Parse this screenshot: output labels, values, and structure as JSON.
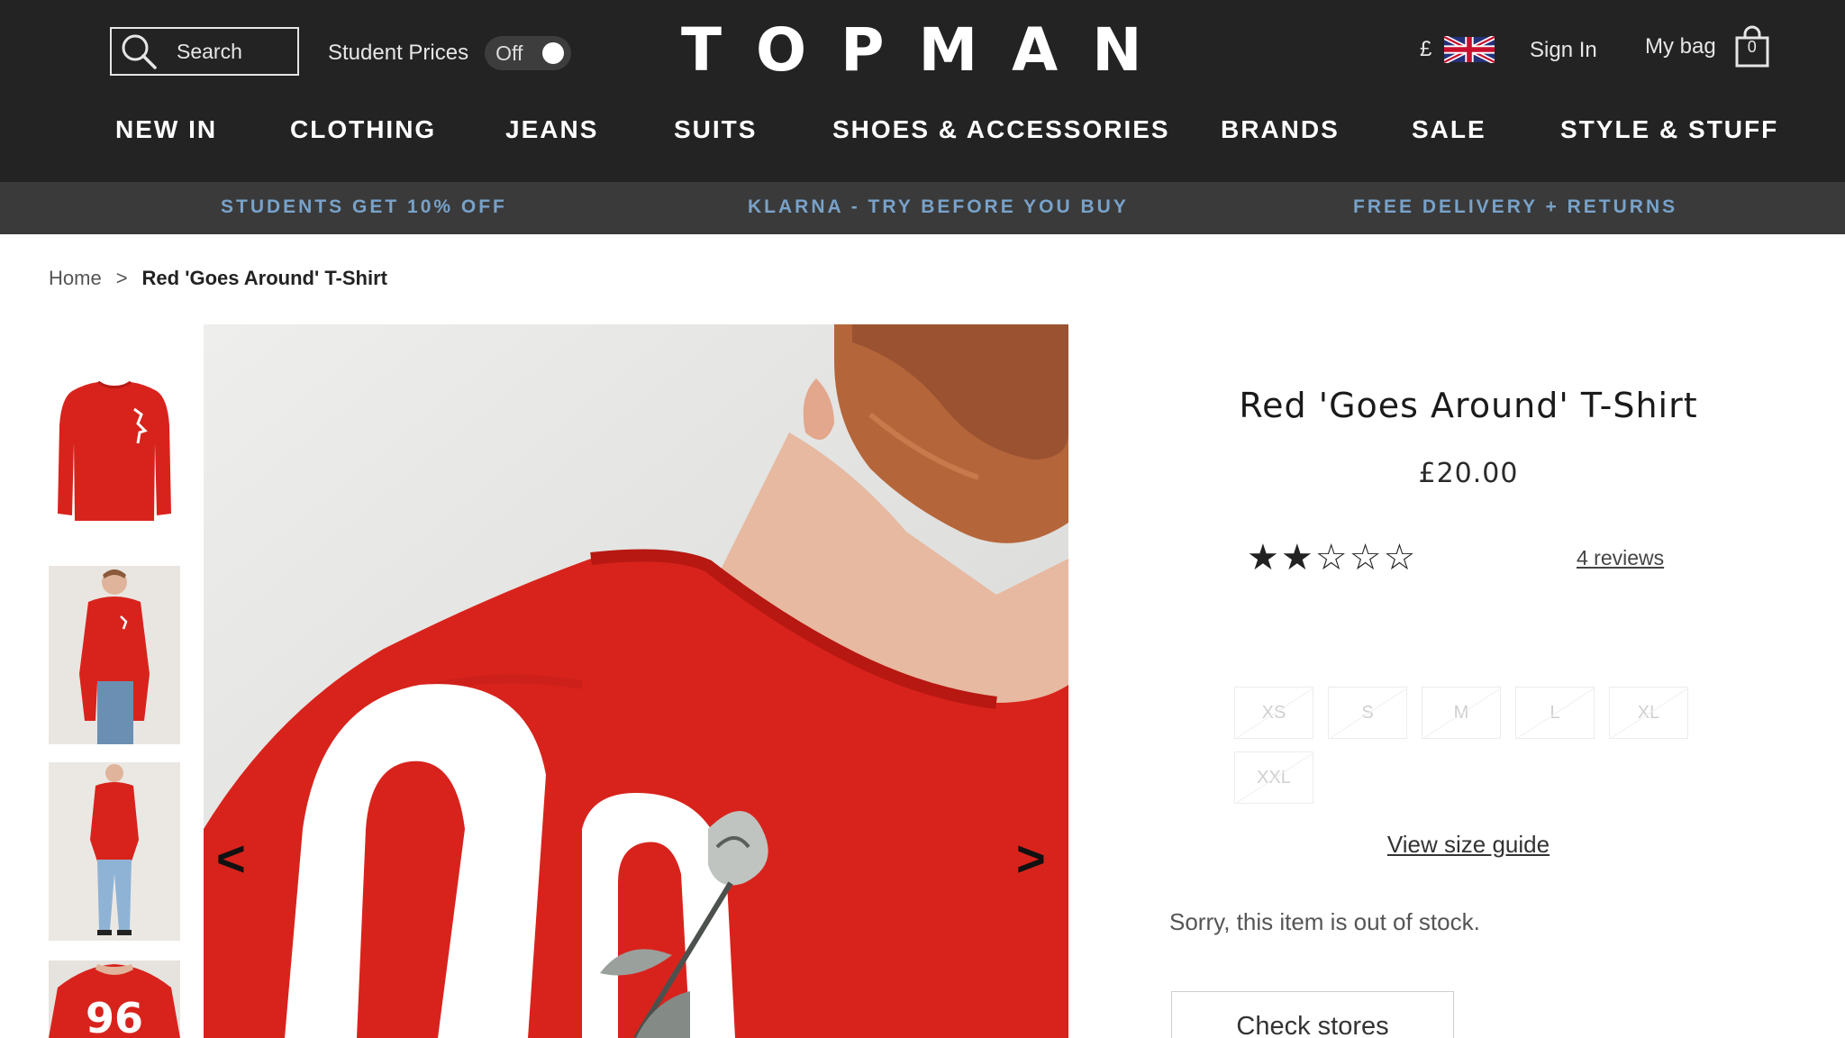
{
  "header": {
    "search_label": "Search",
    "student_prices_label": "Student Prices",
    "student_toggle_value": "Off",
    "logo": "TOPMAN",
    "currency_symbol": "£",
    "sign_in": "Sign In",
    "my_bag": "My bag",
    "bag_count": "0"
  },
  "nav": {
    "items": [
      "NEW IN",
      "CLOTHING",
      "JEANS",
      "SUITS",
      "SHOES & ACCESSORIES",
      "BRANDS",
      "SALE",
      "STYLE & STUFF"
    ]
  },
  "promo": {
    "items": [
      "STUDENTS GET 10% OFF",
      "KLARNA - TRY BEFORE YOU BUY",
      "FREE DELIVERY + RETURNS"
    ]
  },
  "breadcrumb": {
    "home": "Home",
    "separator": ">",
    "current": "Red 'Goes Around' T-Shirt"
  },
  "gallery": {
    "prev_arrow": "<",
    "next_arrow": ">",
    "thumbnail_count": 4
  },
  "product": {
    "title": "Red 'Goes Around' T-Shirt",
    "price": "£20.00",
    "rating": 2,
    "rating_max": 5,
    "reviews_link": "4 reviews",
    "sizes": [
      "XS",
      "S",
      "M",
      "L",
      "XL",
      "XXL"
    ],
    "size_guide": "View size guide",
    "stock_message": "Sorry, this item is out of stock.",
    "check_stores": "Check stores"
  },
  "colors": {
    "header_bg": "#232323",
    "promo_bg": "#3a3a3a",
    "promo_text": "#78a2c9",
    "product_red": "#d8231c"
  }
}
